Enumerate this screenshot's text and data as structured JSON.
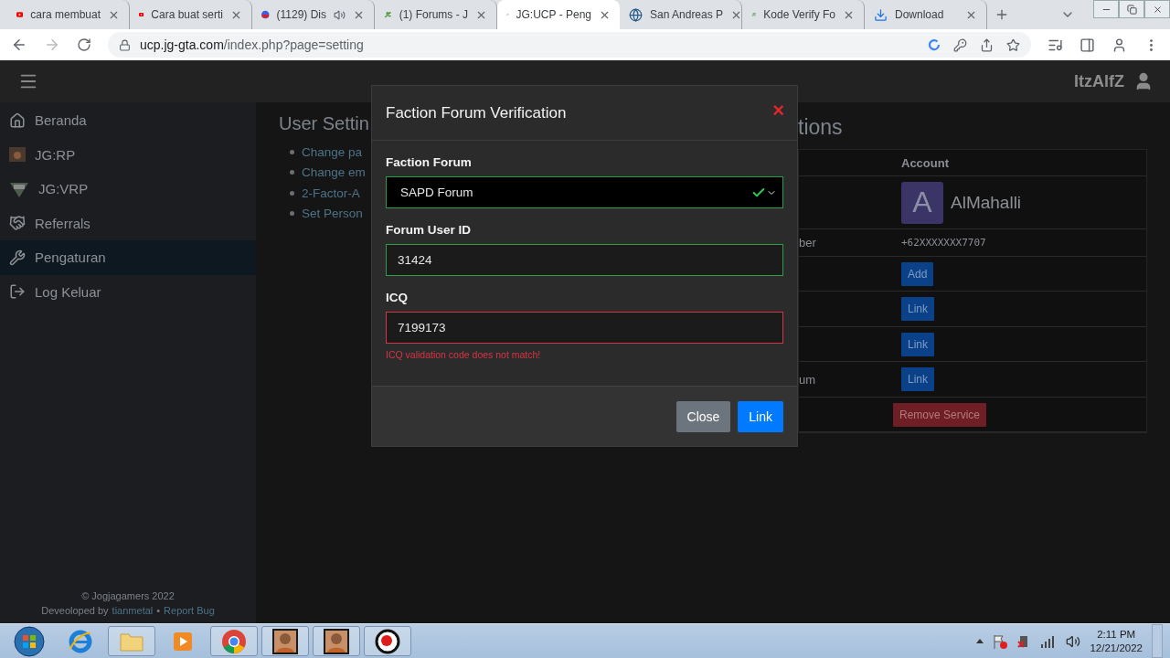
{
  "browser": {
    "tabs": [
      {
        "kind": "youtube",
        "title": "cara membuat",
        "selected": false,
        "playing": false
      },
      {
        "kind": "youtube",
        "title": "Cara buat serti",
        "selected": false,
        "playing": false
      },
      {
        "kind": "badge",
        "title": "(1129) Dis",
        "selected": false,
        "playing": true
      },
      {
        "kind": "jg",
        "title": "(1) Forums - J",
        "selected": false,
        "playing": false
      },
      {
        "kind": "jg",
        "title": "JG:UCP - Peng",
        "selected": true,
        "playing": false
      },
      {
        "kind": "globe",
        "title": "San Andreas P",
        "selected": false,
        "playing": false
      },
      {
        "kind": "jg",
        "title": "Kode Verify Fo",
        "selected": false,
        "playing": false
      },
      {
        "kind": "download",
        "title": "Download",
        "selected": false,
        "playing": false
      }
    ],
    "url": {
      "host": "ucp.jg-gta.com",
      "path": "/index.php?page=setting"
    }
  },
  "navbar": {
    "username": "ItzAlfZ"
  },
  "sidebar": {
    "items": [
      {
        "kind": "home",
        "label": "Beranda",
        "selected": false
      },
      {
        "kind": "rp",
        "label": "JG:RP",
        "selected": false
      },
      {
        "kind": "vrp",
        "label": "JG:VRP",
        "selected": false
      },
      {
        "kind": "handshake",
        "label": "Referrals",
        "selected": false
      },
      {
        "kind": "tools",
        "label": "Pengaturan",
        "selected": true
      },
      {
        "kind": "logout",
        "label": "Log Keluar",
        "selected": false
      }
    ],
    "footer": {
      "copyright": "© Jogjagamers 2022",
      "credit": "Deveoloped by",
      "author": "tianmetal",
      "separator": "•",
      "report": "Report Bug"
    }
  },
  "settings": {
    "heading": "User Settin",
    "links": [
      "Change pa",
      "Change em",
      "2-Factor-A",
      "Set Person"
    ]
  },
  "associations": {
    "heading": "tions",
    "column": "Account",
    "account": {
      "initial": "A",
      "name": "AlMahalli"
    },
    "rows": [
      {
        "kind": "text",
        "label": "ber",
        "value": "+62XXXXXXX7707"
      },
      {
        "kind": "button",
        "button": "Add"
      },
      {
        "kind": "button",
        "button": "Link"
      },
      {
        "kind": "button",
        "button": "Link"
      },
      {
        "kind": "button",
        "label": "um",
        "button": "Link"
      },
      {
        "kind": "danger",
        "button": "Remove Service"
      }
    ]
  },
  "modal": {
    "title": "Faction Forum Verification",
    "close": "×",
    "fields": [
      {
        "kind": "select",
        "label": "Faction Forum",
        "value": "SAPD Forum",
        "valid": true
      },
      {
        "kind": "input",
        "label": "Forum User ID",
        "value": "31424",
        "valid": true
      },
      {
        "kind": "input",
        "label": "ICQ",
        "value": "7199173",
        "valid": false,
        "error": "ICQ validation code does not match!"
      }
    ],
    "buttons": [
      {
        "kind": "secondary",
        "label": "Close"
      },
      {
        "kind": "primary",
        "label": "Link"
      }
    ]
  },
  "taskbar": {
    "apps": [
      {
        "kind": "explorer"
      },
      {
        "kind": "ie"
      },
      {
        "kind": "folder"
      },
      {
        "kind": "media"
      },
      {
        "kind": "chrome"
      },
      {
        "kind": "character"
      },
      {
        "kind": "character"
      },
      {
        "kind": "record"
      }
    ],
    "time": "2:11 PM",
    "date": "12/21/2022"
  }
}
